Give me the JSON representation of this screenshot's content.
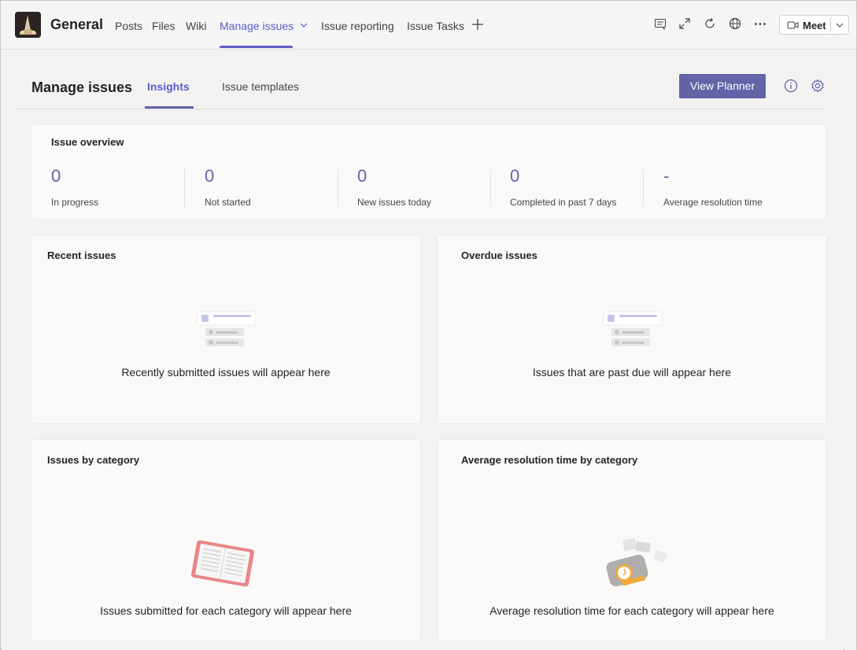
{
  "header": {
    "channel_name": "General",
    "tabs": [
      {
        "label": "Posts"
      },
      {
        "label": "Files"
      },
      {
        "label": "Wiki"
      },
      {
        "label": "Manage issues"
      },
      {
        "label": "Issue reporting"
      },
      {
        "label": "Issue Tasks"
      }
    ],
    "active_tab": "Manage issues",
    "meet_label": "Meet"
  },
  "subheader": {
    "title": "Manage issues",
    "tabs": [
      {
        "label": "Insights"
      },
      {
        "label": "Issue templates"
      }
    ],
    "active_tab": "Insights",
    "view_planner_label": "View Planner"
  },
  "overview": {
    "title": "Issue overview",
    "stats": [
      {
        "value": "0",
        "label": "In progress"
      },
      {
        "value": "0",
        "label": "Not started"
      },
      {
        "value": "0",
        "label": "New issues today"
      },
      {
        "value": "0",
        "label": "Completed in past 7 days"
      },
      {
        "value": "-",
        "label": "Average resolution time"
      }
    ]
  },
  "cards": {
    "recent": {
      "title": "Recent issues",
      "empty": "Recently submitted issues will appear here"
    },
    "overdue": {
      "title": "Overdue issues",
      "empty": "Issues that are past due will appear here"
    },
    "by_category": {
      "title": "Issues by category",
      "empty": "Issues submitted for each category will appear here"
    },
    "resolution": {
      "title": "Average resolution time by category",
      "empty": "Average resolution time for each category will appear here"
    }
  },
  "colors": {
    "accent": "#6264a7",
    "active_tab": "#5b5fc7",
    "background": "#f3f2f1",
    "card": "#faf9f8"
  }
}
